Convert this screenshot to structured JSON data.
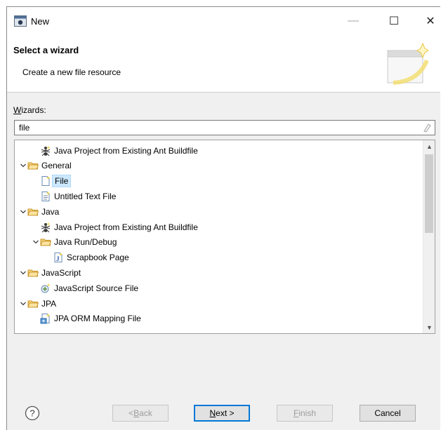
{
  "window": {
    "title": "New",
    "controls": {
      "minimize": "—",
      "maximize": "☐",
      "close": "✕"
    }
  },
  "banner": {
    "title": "Select a wizard",
    "description": "Create a new file resource"
  },
  "wizards": {
    "label_prefix": "W",
    "label_rest": "izards:",
    "filter_value": "file"
  },
  "tree": {
    "items": [
      {
        "label": "Java Project from Existing Ant Buildfile",
        "depth": 1,
        "expanded": null,
        "icon": "ant-project-icon",
        "selected": false
      },
      {
        "label": "General",
        "depth": 0,
        "expanded": true,
        "icon": "folder-icon",
        "selected": false
      },
      {
        "label": "File",
        "depth": 1,
        "expanded": null,
        "icon": "new-file-icon",
        "selected": true
      },
      {
        "label": "Untitled Text File",
        "depth": 1,
        "expanded": null,
        "icon": "text-file-icon",
        "selected": false
      },
      {
        "label": "Java",
        "depth": 0,
        "expanded": true,
        "icon": "folder-icon",
        "selected": false
      },
      {
        "label": "Java Project from Existing Ant Buildfile",
        "depth": 1,
        "expanded": null,
        "icon": "ant-project-icon",
        "selected": false
      },
      {
        "label": "Java Run/Debug",
        "depth": 1,
        "expanded": true,
        "icon": "folder-icon",
        "selected": false
      },
      {
        "label": "Scrapbook Page",
        "depth": 2,
        "expanded": null,
        "icon": "scrapbook-icon",
        "selected": false
      },
      {
        "label": "JavaScript",
        "depth": 0,
        "expanded": true,
        "icon": "folder-icon",
        "selected": false
      },
      {
        "label": "JavaScript Source File",
        "depth": 1,
        "expanded": null,
        "icon": "js-file-icon",
        "selected": false
      },
      {
        "label": "JPA",
        "depth": 0,
        "expanded": true,
        "icon": "folder-icon",
        "selected": false
      },
      {
        "label": "JPA ORM Mapping File",
        "depth": 1,
        "expanded": null,
        "icon": "jpa-mapping-icon",
        "selected": false
      }
    ]
  },
  "buttons": {
    "back": {
      "prefix": "< ",
      "mnemonic": "B",
      "rest": "ack"
    },
    "next": {
      "mnemonic": "N",
      "rest": "ext >"
    },
    "finish": {
      "mnemonic": "F",
      "rest": "inish"
    },
    "cancel": "Cancel",
    "help": "?"
  },
  "colors": {
    "selection": "#cce8ff",
    "folder": "#e8b84a",
    "accent": "#0078d7"
  }
}
